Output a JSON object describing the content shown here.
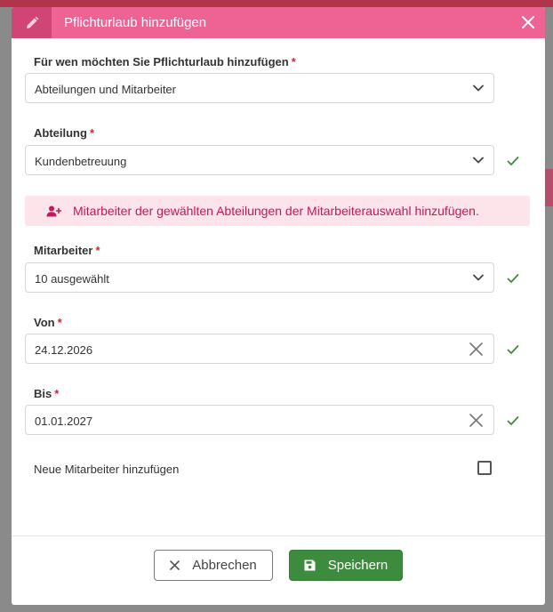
{
  "modal": {
    "title": "Pflichturlaub hinzufügen"
  },
  "fields": {
    "target": {
      "label": "Für wen möchten Sie Pflichturlaub hinzufügen",
      "required": "*",
      "value": "Abteilungen und Mitarbeiter"
    },
    "department": {
      "label": "Abteilung",
      "required": "*",
      "value": "Kundenbetreuung"
    },
    "info": {
      "text": "Mitarbeiter der gewählten Abteilungen der Mitarbeiterauswahl hinzufügen."
    },
    "employees": {
      "label": "Mitarbeiter",
      "required": "*",
      "value": "10 ausgewählt"
    },
    "from": {
      "label": "Von",
      "required": "*",
      "value": "24.12.2026"
    },
    "to": {
      "label": "Bis",
      "required": "*",
      "value": "01.01.2027"
    },
    "new_employees": {
      "label": "Neue Mitarbeiter hinzufügen",
      "checked": false
    }
  },
  "footer": {
    "cancel_label": "Abbrechen",
    "save_label": "Speichern"
  },
  "colors": {
    "header": "#ee6393",
    "header_icon_bg": "#d14576",
    "required": "#d6213f",
    "valid_check": "#3d8b3d",
    "info_bg": "#fce4ea",
    "info_text": "#c2185b",
    "save_button": "#3d8b3d"
  },
  "icons": {
    "header": "pencil-icon",
    "close": "close-icon",
    "select": "chevron-down-icon",
    "valid": "check-icon",
    "info": "user-plus-icon",
    "clear": "clear-x-icon",
    "cancel": "x-icon",
    "save": "floppy-disk-icon"
  }
}
